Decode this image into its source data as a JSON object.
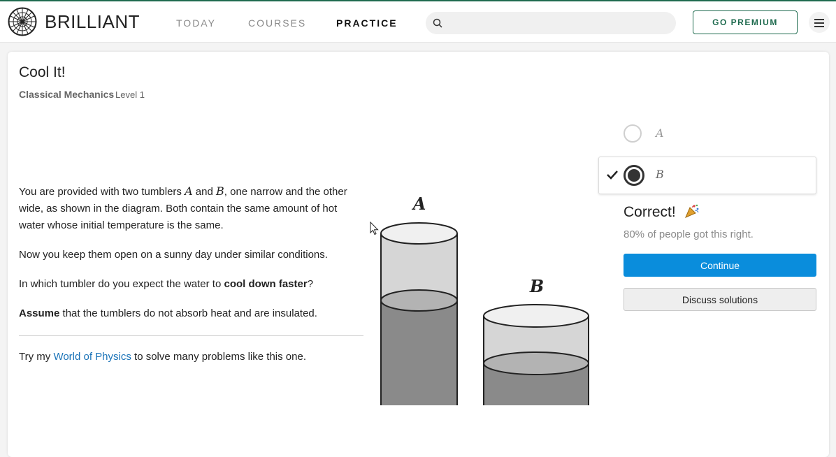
{
  "header": {
    "brand": "BRILLIANT",
    "nav": [
      {
        "label": "TODAY",
        "active": false
      },
      {
        "label": "COURSES",
        "active": false
      },
      {
        "label": "PRACTICE",
        "active": true
      }
    ],
    "search_placeholder": "",
    "premium_label": "GO PREMIUM",
    "menu_icon": "hamburger-icon"
  },
  "problem": {
    "title": "Cool It!",
    "course": "Classical Mechanics",
    "level": "Level 1",
    "p1": {
      "t1": "You are provided with two tumblers ",
      "var_a": "A",
      "t2": " and ",
      "var_b": "B",
      "t3": ", one narrow and the other wide, as shown in the diagram. Both contain the same amount of hot water whose initial temperature is the same."
    },
    "p2": "Now you keep them open on a sunny day under similar conditions.",
    "p3": {
      "pre": "In which tumbler do you expect the water to ",
      "bold": "cool down faster",
      "post": "?"
    },
    "p4": {
      "bold": "Assume",
      "rest": " that the tumblers do not absorb heat and are insulated."
    },
    "promo": {
      "pre": "Try my ",
      "link": "World of Physics",
      "post": " to solve many problems like this one."
    }
  },
  "diagram": {
    "label_a": "A",
    "label_b": "B"
  },
  "answers": {
    "options": [
      {
        "label": "A",
        "selected": false
      },
      {
        "label": "B",
        "selected": true
      }
    ],
    "result": "Correct!",
    "stat": "80% of people got this right.",
    "continue_label": "Continue",
    "discuss_label": "Discuss solutions"
  },
  "colors": {
    "accent": "#0a8ddc",
    "premium": "#1f6b4f",
    "link": "#1a73b8"
  }
}
